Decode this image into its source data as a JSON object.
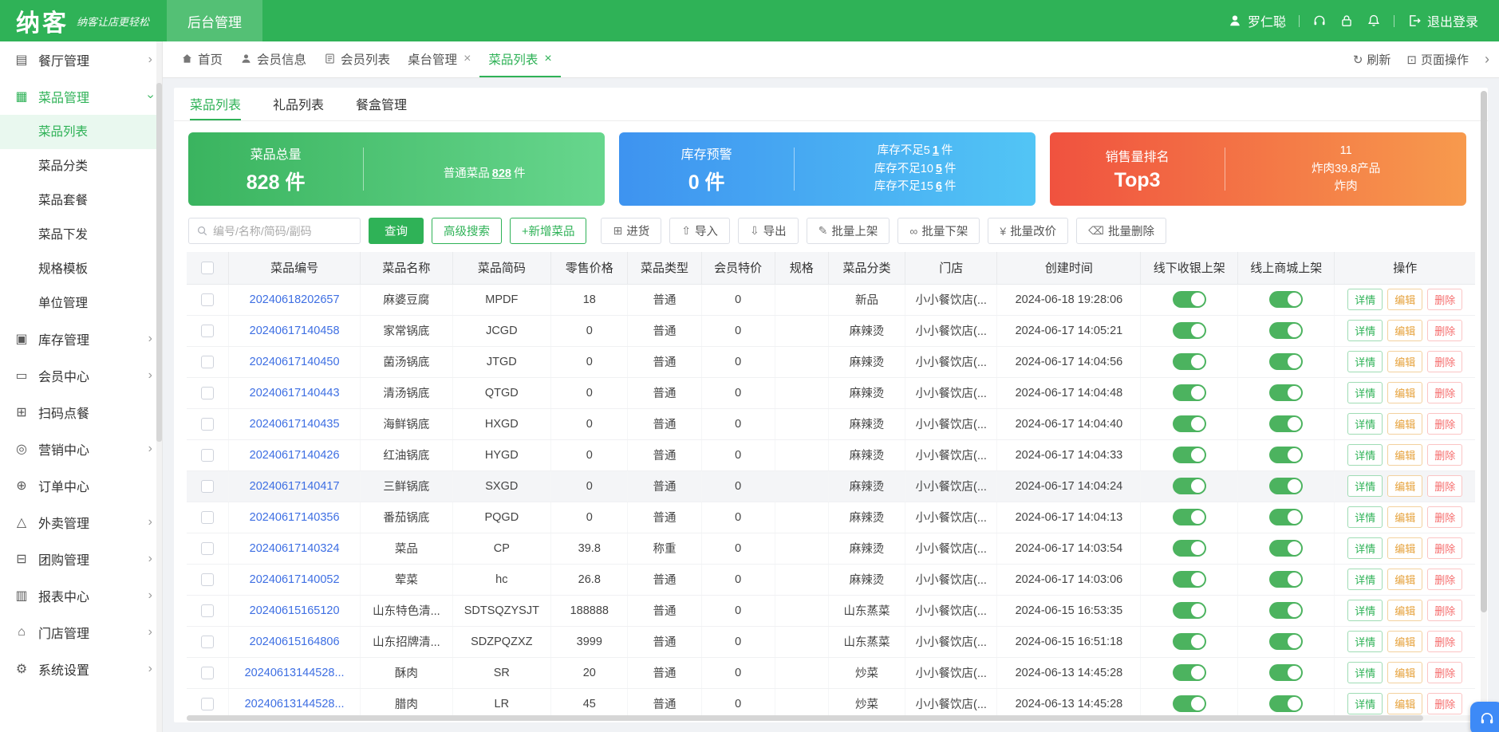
{
  "header": {
    "logo": "纳客",
    "slogan": "纳客让店更轻松",
    "nav_tab": "后台管理",
    "username": "罗仁聪",
    "logout_label": "退出登录"
  },
  "sidebar": {
    "items": [
      {
        "label": "餐厅管理",
        "icon": "restaurant-icon",
        "glyph": "▤",
        "arrow": "right"
      },
      {
        "label": "菜品管理",
        "icon": "dish-icon",
        "glyph": "▦",
        "arrow": "down",
        "active": true,
        "children": [
          {
            "label": "菜品列表",
            "active": true
          },
          {
            "label": "菜品分类"
          },
          {
            "label": "菜品套餐"
          },
          {
            "label": "菜品下发"
          },
          {
            "label": "规格模板"
          },
          {
            "label": "单位管理"
          }
        ]
      },
      {
        "label": "库存管理",
        "icon": "inventory-icon",
        "glyph": "▣",
        "arrow": "right"
      },
      {
        "label": "会员中心",
        "icon": "member-center-icon",
        "glyph": "▭",
        "arrow": "right"
      },
      {
        "label": "扫码点餐",
        "icon": "qr-order-icon",
        "glyph": "⊞"
      },
      {
        "label": "营销中心",
        "icon": "marketing-icon",
        "glyph": "◎",
        "arrow": "right"
      },
      {
        "label": "订单中心",
        "icon": "order-center-icon",
        "glyph": "⊕"
      },
      {
        "label": "外卖管理",
        "icon": "takeout-icon",
        "glyph": "△",
        "arrow": "right"
      },
      {
        "label": "团购管理",
        "icon": "groupbuy-icon",
        "glyph": "⊟",
        "arrow": "right"
      },
      {
        "label": "报表中心",
        "icon": "report-icon",
        "glyph": "▥",
        "arrow": "right"
      },
      {
        "label": "门店管理",
        "icon": "store-icon",
        "glyph": "⌂",
        "arrow": "right"
      },
      {
        "label": "系统设置",
        "icon": "settings-icon",
        "glyph": "⚙",
        "arrow": "right"
      }
    ]
  },
  "tabbar": {
    "tabs": [
      {
        "label": "首页",
        "icon": "home-icon",
        "closable": false
      },
      {
        "label": "会员信息",
        "icon": "member-info-icon",
        "closable": false
      },
      {
        "label": "会员列表",
        "icon": "member-list-icon",
        "closable": false
      },
      {
        "label": "桌台管理",
        "closable": true
      },
      {
        "label": "菜品列表",
        "closable": true,
        "active": true
      }
    ],
    "refresh_label": "刷新",
    "page_ops_label": "页面操作"
  },
  "subtabs": [
    {
      "label": "菜品列表",
      "active": true
    },
    {
      "label": "礼品列表"
    },
    {
      "label": "餐盒管理"
    }
  ],
  "stat_cards": [
    {
      "type": "green",
      "title": "菜品总量",
      "value": "828 件",
      "right_lines": [
        {
          "label": "普通菜品",
          "num": "828",
          "unit": "件"
        }
      ]
    },
    {
      "type": "blue",
      "title": "库存预警",
      "value": "0 件",
      "right_lines": [
        {
          "label": "库存不足5",
          "num": "1",
          "unit": "件"
        },
        {
          "label": "库存不足10",
          "num": "5",
          "unit": "件"
        },
        {
          "label": "库存不足15",
          "num": "6",
          "unit": "件"
        }
      ]
    },
    {
      "type": "orange",
      "title": "销售量排名",
      "value": "Top3",
      "right_lines": [
        {
          "label": "11"
        },
        {
          "label": "炸肉39.8产品"
        },
        {
          "label": "炸肉"
        }
      ]
    }
  ],
  "toolbar": {
    "search_placeholder": "编号/名称/简码/副码",
    "search_button": "查询",
    "advanced_search": "高级搜索",
    "add_item": "+新增菜品",
    "buttons": [
      {
        "label": "进货",
        "icon": "stock-in-icon",
        "glyph": "⊞"
      },
      {
        "label": "导入",
        "icon": "import-icon",
        "glyph": "⇧"
      },
      {
        "label": "导出",
        "icon": "export-icon",
        "glyph": "⇩"
      },
      {
        "label": "批量上架",
        "icon": "batch-onshelf-icon",
        "glyph": "✎"
      },
      {
        "label": "批量下架",
        "icon": "batch-offshelf-icon",
        "glyph": "∞"
      },
      {
        "label": "批量改价",
        "icon": "batch-reprice-icon",
        "glyph": "¥"
      },
      {
        "label": "批量删除",
        "icon": "batch-delete-icon",
        "glyph": "⌫"
      }
    ]
  },
  "table": {
    "columns": [
      "菜品编号",
      "菜品名称",
      "菜品简码",
      "零售价格",
      "菜品类型",
      "会员特价",
      "规格",
      "菜品分类",
      "门店",
      "创建时间",
      "线下收银上架",
      "线上商城上架",
      "操作"
    ],
    "actions": [
      "详情",
      "编辑",
      "删除"
    ],
    "rows": [
      {
        "id": "20240618202657",
        "name": "麻婆豆腐",
        "code": "MPDF",
        "price": "18",
        "type": "普通",
        "member_price": "0",
        "spec": "",
        "category": "新品",
        "store": "小小餐饮店(...",
        "created": "2024-06-18 19:28:06",
        "offline": true,
        "online": true
      },
      {
        "id": "20240617140458",
        "name": "家常锅底",
        "code": "JCGD",
        "price": "0",
        "type": "普通",
        "member_price": "0",
        "spec": "",
        "category": "麻辣烫",
        "store": "小小餐饮店(...",
        "created": "2024-06-17 14:05:21",
        "offline": true,
        "online": true
      },
      {
        "id": "20240617140450",
        "name": "菌汤锅底",
        "code": "JTGD",
        "price": "0",
        "type": "普通",
        "member_price": "0",
        "spec": "",
        "category": "麻辣烫",
        "store": "小小餐饮店(...",
        "created": "2024-06-17 14:04:56",
        "offline": true,
        "online": true
      },
      {
        "id": "20240617140443",
        "name": "清汤锅底",
        "code": "QTGD",
        "price": "0",
        "type": "普通",
        "member_price": "0",
        "spec": "",
        "category": "麻辣烫",
        "store": "小小餐饮店(...",
        "created": "2024-06-17 14:04:48",
        "offline": true,
        "online": true
      },
      {
        "id": "20240617140435",
        "name": "海鲜锅底",
        "code": "HXGD",
        "price": "0",
        "type": "普通",
        "member_price": "0",
        "spec": "",
        "category": "麻辣烫",
        "store": "小小餐饮店(...",
        "created": "2024-06-17 14:04:40",
        "offline": true,
        "online": true
      },
      {
        "id": "20240617140426",
        "name": "红油锅底",
        "code": "HYGD",
        "price": "0",
        "type": "普通",
        "member_price": "0",
        "spec": "",
        "category": "麻辣烫",
        "store": "小小餐饮店(...",
        "created": "2024-06-17 14:04:33",
        "offline": true,
        "online": true
      },
      {
        "id": "20240617140417",
        "name": "三鲜锅底",
        "code": "SXGD",
        "price": "0",
        "type": "普通",
        "member_price": "0",
        "spec": "",
        "category": "麻辣烫",
        "store": "小小餐饮店(...",
        "created": "2024-06-17 14:04:24",
        "offline": true,
        "online": true,
        "highlighted": true
      },
      {
        "id": "20240617140356",
        "name": "番茄锅底",
        "code": "PQGD",
        "price": "0",
        "type": "普通",
        "member_price": "0",
        "spec": "",
        "category": "麻辣烫",
        "store": "小小餐饮店(...",
        "created": "2024-06-17 14:04:13",
        "offline": true,
        "online": true
      },
      {
        "id": "20240617140324",
        "name": "菜品",
        "code": "CP",
        "price": "39.8",
        "type": "称重",
        "member_price": "0",
        "spec": "",
        "category": "麻辣烫",
        "store": "小小餐饮店(...",
        "created": "2024-06-17 14:03:54",
        "offline": true,
        "online": true
      },
      {
        "id": "20240617140052",
        "name": "荤菜",
        "code": "hc",
        "price": "26.8",
        "type": "普通",
        "member_price": "0",
        "spec": "",
        "category": "麻辣烫",
        "store": "小小餐饮店(...",
        "created": "2024-06-17 14:03:06",
        "offline": true,
        "online": true
      },
      {
        "id": "20240615165120",
        "name": "山东特色清...",
        "code": "SDTSQZYSJT",
        "price": "188888",
        "type": "普通",
        "member_price": "0",
        "spec": "",
        "category": "山东蒸菜",
        "store": "小小餐饮店(...",
        "created": "2024-06-15 16:53:35",
        "offline": true,
        "online": true
      },
      {
        "id": "20240615164806",
        "name": "山东招牌清...",
        "code": "SDZPQZXZ",
        "price": "3999",
        "type": "普通",
        "member_price": "0",
        "spec": "",
        "category": "山东蒸菜",
        "store": "小小餐饮店(...",
        "created": "2024-06-15 16:51:18",
        "offline": true,
        "online": true
      },
      {
        "id": "20240613144528...",
        "name": "酥肉",
        "code": "SR",
        "price": "20",
        "type": "普通",
        "member_price": "0",
        "spec": "",
        "category": "炒菜",
        "store": "小小餐饮店(...",
        "created": "2024-06-13 14:45:28",
        "offline": true,
        "online": true
      },
      {
        "id": "20240613144528...",
        "name": "腊肉",
        "code": "LR",
        "price": "45",
        "type": "普通",
        "member_price": "0",
        "spec": "",
        "category": "炒菜",
        "store": "小小餐饮店(...",
        "created": "2024-06-13 14:45:28",
        "offline": true,
        "online": true
      }
    ]
  },
  "colors": {
    "brand_green": "#2fb257",
    "card_green": [
      "#3ab45f",
      "#67d68d"
    ],
    "card_blue": [
      "#3e93f0",
      "#52c5f5"
    ],
    "card_orange": [
      "#f0523f",
      "#f79a4d"
    ],
    "link_blue": "#3e6fe3",
    "toggle_on": "#4cb35f",
    "action_detail": "#2fb257",
    "action_edit": "#e6a23c",
    "action_delete": "#f56c6c"
  }
}
